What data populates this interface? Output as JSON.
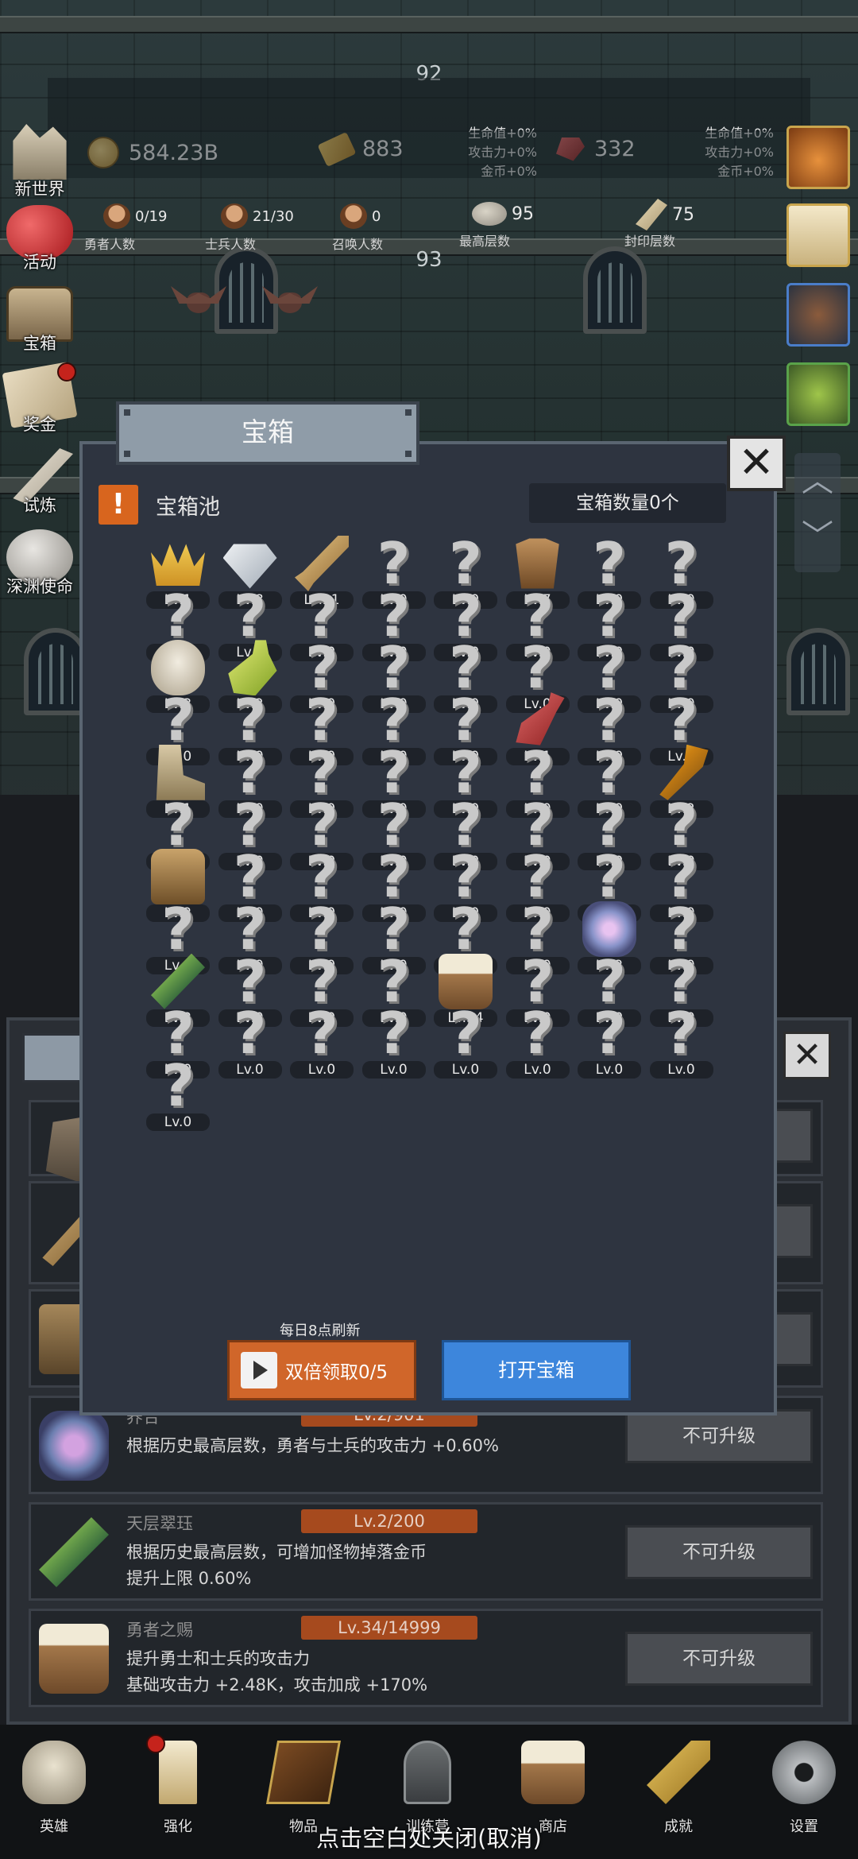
{
  "floors": {
    "upper": "92",
    "lower": "93"
  },
  "stats": {
    "gold": "584.23B",
    "bars": "883",
    "bars_bonus": [
      "生命值+0%",
      "攻击力+0%",
      "金币+0%"
    ],
    "gems": "332",
    "gems_bonus": [
      "生命值+0%",
      "攻击力+0%",
      "金币+0%"
    ]
  },
  "units": {
    "heroes_value": "0/19",
    "heroes_label": "勇者人数",
    "soldiers_value": "21/30",
    "soldiers_label": "士兵人数",
    "summons_value": "0",
    "summons_label": "召唤人数",
    "max_floor_value": "95",
    "max_floor_label": "最高层数",
    "sealed_value": "75",
    "sealed_label": "封印层数"
  },
  "side_menu": [
    {
      "label": "新世界",
      "icon": "ruins-icon"
    },
    {
      "label": "活动",
      "icon": "heart-icon"
    },
    {
      "label": "宝箱",
      "icon": "chest-icon"
    },
    {
      "label": "奖金",
      "icon": "envelope-icon"
    },
    {
      "label": "试炼",
      "icon": "feather-icon"
    },
    {
      "label": "深渊使命",
      "icon": "egg-icon"
    }
  ],
  "modal": {
    "title": "宝箱",
    "pool_label": "宝箱池",
    "warn_mark": "!",
    "count_text": "宝箱数量0个",
    "refresh_note": "每日8点刷新",
    "double_btn": "双倍领取0/5",
    "open_btn": "打开宝箱",
    "close_glyph": "✕"
  },
  "chest_pool": [
    {
      "icon": "crown-icon",
      "lv": "Lv.1"
    },
    {
      "icon": "diamond-icon",
      "lv": "Lv.8"
    },
    {
      "icon": "sword-icon",
      "lv": "Lv.21"
    },
    {
      "icon": "unknown-icon",
      "lv": "Lv.0"
    },
    {
      "icon": "unknown-icon",
      "lv": "Lv.0"
    },
    {
      "icon": "armor-icon",
      "lv": "Lv.7"
    },
    {
      "icon": "unknown-icon",
      "lv": "Lv.0"
    },
    {
      "icon": "unknown-icon",
      "lv": "Lv.0"
    },
    {
      "icon": "unknown-icon",
      "lv": "Lv.0"
    },
    {
      "icon": "unknown-icon",
      "lv": "Lv.0"
    },
    {
      "icon": "unknown-icon",
      "lv": "Lv.0"
    },
    {
      "icon": "unknown-icon",
      "lv": "Lv.0"
    },
    {
      "icon": "unknown-icon",
      "lv": "Lv.0"
    },
    {
      "icon": "unknown-icon",
      "lv": "Lv.0"
    },
    {
      "icon": "unknown-icon",
      "lv": "Lv.0"
    },
    {
      "icon": "unknown-icon",
      "lv": "Lv.0"
    },
    {
      "icon": "bowl-icon",
      "lv": "Lv.3"
    },
    {
      "icon": "potion-icon",
      "lv": "Lv.2"
    },
    {
      "icon": "unknown-icon",
      "lv": "Lv.0"
    },
    {
      "icon": "unknown-icon",
      "lv": "Lv.0"
    },
    {
      "icon": "unknown-icon",
      "lv": "Lv.0"
    },
    {
      "icon": "unknown-icon",
      "lv": "Lv.0"
    },
    {
      "icon": "unknown-icon",
      "lv": "Lv.0"
    },
    {
      "icon": "unknown-icon",
      "lv": "Lv.0"
    },
    {
      "icon": "unknown-icon",
      "lv": "Lv.0"
    },
    {
      "icon": "unknown-icon",
      "lv": "Lv.0"
    },
    {
      "icon": "unknown-icon",
      "lv": "Lv.0"
    },
    {
      "icon": "unknown-icon",
      "lv": "Lv.0"
    },
    {
      "icon": "unknown-icon",
      "lv": "Lv.0"
    },
    {
      "icon": "flask-icon",
      "lv": "Lv.1"
    },
    {
      "icon": "unknown-icon",
      "lv": "Lv.0"
    },
    {
      "icon": "unknown-icon",
      "lv": "Lv.0"
    },
    {
      "icon": "boot-icon",
      "lv": "Lv.1"
    },
    {
      "icon": "unknown-icon",
      "lv": "Lv.0"
    },
    {
      "icon": "unknown-icon",
      "lv": "Lv.0"
    },
    {
      "icon": "unknown-icon",
      "lv": "Lv.0"
    },
    {
      "icon": "unknown-icon",
      "lv": "Lv.0"
    },
    {
      "icon": "unknown-icon",
      "lv": "Lv.0"
    },
    {
      "icon": "unknown-icon",
      "lv": "Lv.0"
    },
    {
      "icon": "torch-icon",
      "lv": "Lv.2"
    },
    {
      "icon": "unknown-icon",
      "lv": "Lv.0"
    },
    {
      "icon": "unknown-icon",
      "lv": "Lv.0"
    },
    {
      "icon": "unknown-icon",
      "lv": "Lv.0"
    },
    {
      "icon": "unknown-icon",
      "lv": "Lv.0"
    },
    {
      "icon": "unknown-icon",
      "lv": "Lv.0"
    },
    {
      "icon": "unknown-icon",
      "lv": "Lv.0"
    },
    {
      "icon": "unknown-icon",
      "lv": "Lv.0"
    },
    {
      "icon": "unknown-icon",
      "lv": "Lv.0"
    },
    {
      "icon": "backpack-icon",
      "lv": "Lv.2"
    },
    {
      "icon": "unknown-icon",
      "lv": "Lv.0"
    },
    {
      "icon": "unknown-icon",
      "lv": "Lv.0"
    },
    {
      "icon": "unknown-icon",
      "lv": "Lv.0"
    },
    {
      "icon": "unknown-icon",
      "lv": "Lv.0"
    },
    {
      "icon": "unknown-icon",
      "lv": "Lv.0"
    },
    {
      "icon": "unknown-icon",
      "lv": "Lv.0"
    },
    {
      "icon": "unknown-icon",
      "lv": "Lv.0"
    },
    {
      "icon": "unknown-icon",
      "lv": "Lv.0"
    },
    {
      "icon": "unknown-icon",
      "lv": "Lv.0"
    },
    {
      "icon": "unknown-icon",
      "lv": "Lv.0"
    },
    {
      "icon": "unknown-icon",
      "lv": "Lv.0"
    },
    {
      "icon": "unknown-icon",
      "lv": "Lv.0"
    },
    {
      "icon": "unknown-icon",
      "lv": "Lv.0"
    },
    {
      "icon": "tentacle-icon",
      "lv": "Lv.2"
    },
    {
      "icon": "unknown-icon",
      "lv": "Lv.0"
    },
    {
      "icon": "jade-icon",
      "lv": "Lv.2"
    },
    {
      "icon": "unknown-icon",
      "lv": "Lv.0"
    },
    {
      "icon": "unknown-icon",
      "lv": "Lv.0"
    },
    {
      "icon": "unknown-icon",
      "lv": "Lv.0"
    },
    {
      "icon": "mug-icon",
      "lv": "Lv.34"
    },
    {
      "icon": "unknown-icon",
      "lv": "Lv.0"
    },
    {
      "icon": "unknown-icon",
      "lv": "Lv.0"
    },
    {
      "icon": "unknown-icon",
      "lv": "Lv.0"
    },
    {
      "icon": "unknown-icon",
      "lv": "Lv.0"
    },
    {
      "icon": "unknown-icon",
      "lv": "Lv.0"
    },
    {
      "icon": "unknown-icon",
      "lv": "Lv.0"
    },
    {
      "icon": "unknown-icon",
      "lv": "Lv.0"
    },
    {
      "icon": "unknown-icon",
      "lv": "Lv.0"
    },
    {
      "icon": "unknown-icon",
      "lv": "Lv.0"
    },
    {
      "icon": "unknown-icon",
      "lv": "Lv.0"
    },
    {
      "icon": "unknown-icon",
      "lv": "Lv.0"
    },
    {
      "icon": "unknown-icon",
      "lv": "Lv.0"
    }
  ],
  "upgrades": [
    {
      "name": "养合",
      "level": "Lv.2/901",
      "desc1": "根据历史最高层数，勇者与士兵的攻击力 +0.60%",
      "desc2": "",
      "button": "不可升级",
      "icon": "tentacle-icon"
    },
    {
      "name": "天层翠珏",
      "level": "Lv.2/200",
      "desc1": "根据历史最高层数，可增加怪物掉落金币",
      "desc2": "提升上限 0.60%",
      "button": "不可升级",
      "icon": "jade-icon"
    },
    {
      "name": "勇者之赐",
      "level": "Lv.34/14999",
      "desc1": "提升勇士和士兵的攻击力",
      "desc2": "基础攻击力 +2.48K，攻击加成 +170%",
      "button": "不可升级",
      "icon": "mug-icon"
    }
  ],
  "bottom_nav": [
    {
      "label": "英雄",
      "icon": "skull-icon"
    },
    {
      "label": "强化",
      "icon": "candle-icon"
    },
    {
      "label": "物品",
      "icon": "book-icon"
    },
    {
      "label": "训练营",
      "icon": "lantern-icon"
    },
    {
      "label": "商店",
      "icon": "mug-icon"
    },
    {
      "label": "成就",
      "icon": "key-icon"
    },
    {
      "label": "设置",
      "icon": "gear-icon"
    }
  ],
  "close_hint": "点击空白处关闭(取消)",
  "colors": {
    "accent_orange": "#d0662a",
    "accent_blue": "#3d86dc",
    "level_badge": "#a64a1e",
    "panel": "#2e3440"
  }
}
